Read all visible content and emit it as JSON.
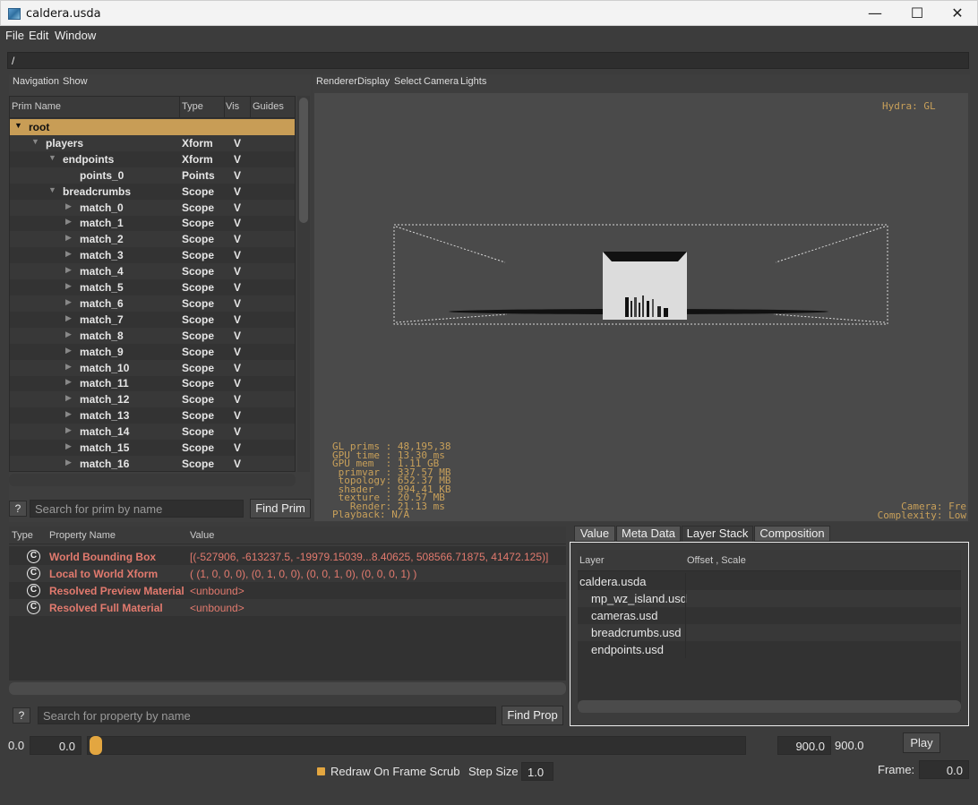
{
  "window": {
    "title": "caldera.usda",
    "minimize_glyph": "—",
    "maximize_glyph": "☐",
    "close_glyph": "✕"
  },
  "menubar": [
    "File",
    "Edit",
    "Window"
  ],
  "path": "/",
  "navigation": {
    "menu": [
      "Navigation",
      "Show"
    ],
    "columns": [
      "Prim Name",
      "Type",
      "Vis",
      "Guides"
    ],
    "rows": [
      {
        "name": "root",
        "type": "",
        "vis": "",
        "depth": 0,
        "expanded": true,
        "selected": true
      },
      {
        "name": "players",
        "type": "Xform",
        "vis": "V",
        "depth": 1,
        "expanded": true
      },
      {
        "name": "endpoints",
        "type": "Xform",
        "vis": "V",
        "depth": 2,
        "expanded": true
      },
      {
        "name": "points_0",
        "type": "Points",
        "vis": "V",
        "depth": 3,
        "leaf": true
      },
      {
        "name": "breadcrumbs",
        "type": "Scope",
        "vis": "V",
        "depth": 2,
        "expanded": true
      },
      {
        "name": "match_0",
        "type": "Scope",
        "vis": "V",
        "depth": 3
      },
      {
        "name": "match_1",
        "type": "Scope",
        "vis": "V",
        "depth": 3
      },
      {
        "name": "match_2",
        "type": "Scope",
        "vis": "V",
        "depth": 3
      },
      {
        "name": "match_3",
        "type": "Scope",
        "vis": "V",
        "depth": 3
      },
      {
        "name": "match_4",
        "type": "Scope",
        "vis": "V",
        "depth": 3
      },
      {
        "name": "match_5",
        "type": "Scope",
        "vis": "V",
        "depth": 3
      },
      {
        "name": "match_6",
        "type": "Scope",
        "vis": "V",
        "depth": 3
      },
      {
        "name": "match_7",
        "type": "Scope",
        "vis": "V",
        "depth": 3
      },
      {
        "name": "match_8",
        "type": "Scope",
        "vis": "V",
        "depth": 3
      },
      {
        "name": "match_9",
        "type": "Scope",
        "vis": "V",
        "depth": 3
      },
      {
        "name": "match_10",
        "type": "Scope",
        "vis": "V",
        "depth": 3
      },
      {
        "name": "match_11",
        "type": "Scope",
        "vis": "V",
        "depth": 3
      },
      {
        "name": "match_12",
        "type": "Scope",
        "vis": "V",
        "depth": 3
      },
      {
        "name": "match_13",
        "type": "Scope",
        "vis": "V",
        "depth": 3
      },
      {
        "name": "match_14",
        "type": "Scope",
        "vis": "V",
        "depth": 3
      },
      {
        "name": "match_15",
        "type": "Scope",
        "vis": "V",
        "depth": 3
      },
      {
        "name": "match_16",
        "type": "Scope",
        "vis": "V",
        "depth": 3
      }
    ],
    "help_label": "?",
    "search_placeholder": "Search for prim by name",
    "find_label": "Find Prim"
  },
  "viewport": {
    "menu": [
      "Renderer",
      "Display",
      "Select",
      "Camera",
      "Lights"
    ],
    "hydra_label": "Hydra: GL",
    "stats_lines": [
      "GL prims : 48,195,38",
      "GPU time : 13.30 ms",
      "GPU mem  : 1.11 GB",
      " primvar : 337.57 MB",
      " topology: 652.37 MB",
      " shader  : 994.41 KB",
      " texture : 20.57 MB",
      "   Render: 21.13 ms",
      "Playback: N/A"
    ],
    "camera_lines": [
      "Camera: Fre",
      "Complexity: Low"
    ]
  },
  "properties": {
    "columns": [
      "Type",
      "Property Name",
      "Value"
    ],
    "rows": [
      {
        "icon": "C",
        "name": "World Bounding Box",
        "value": "[(-527906, -613237.5, -19979.15039...8.40625, 508566.71875, 41472.125)]"
      },
      {
        "icon": "C",
        "name": "Local to World Xform",
        "value": "( (1, 0, 0, 0), (0, 1, 0, 0), (0, 0, 1, 0), (0, 0, 0, 1) )"
      },
      {
        "icon": "C",
        "name": "Resolved Preview Material",
        "value": "<unbound>"
      },
      {
        "icon": "C",
        "name": "Resolved Full Material",
        "value": "<unbound>"
      }
    ],
    "help_label": "?",
    "search_placeholder": "Search for property by name",
    "find_label": "Find Prop"
  },
  "layers": {
    "tabs": [
      "Value",
      "Meta Data",
      "Layer Stack",
      "Composition"
    ],
    "active_tab": "Layer Stack",
    "columns": [
      "Layer",
      "Offset , Scale"
    ],
    "rows": [
      "caldera.usda",
      "mp_wz_island.usd",
      "cameras.usd",
      "breadcrumbs.usd",
      "endpoints.usd"
    ]
  },
  "timeline": {
    "start_label": "0.0",
    "start_value": "0.0",
    "end_value": "900.0",
    "end_label": "900.0",
    "play_label": "Play",
    "redraw_label": "Redraw On Frame Scrub",
    "redraw_checked": true,
    "step_size_label": "Step Size",
    "step_size_value": "1.0",
    "frame_label": "Frame:",
    "frame_value": "0.0"
  },
  "colors": {
    "accent": "#e3a640",
    "selection": "#c89d56",
    "property_text": "#e27a6e",
    "hud_text": "#c8a05a"
  }
}
